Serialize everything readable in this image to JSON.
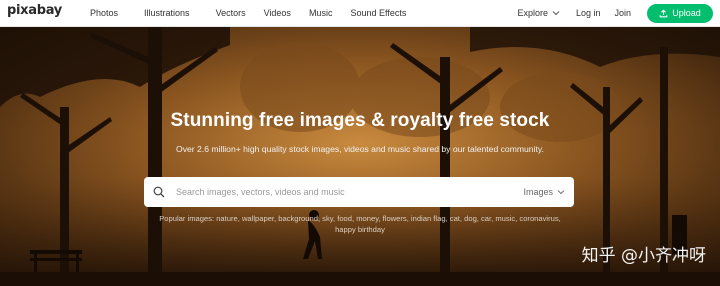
{
  "header": {
    "logo": "pixabay",
    "nav": [
      "Photos",
      "Illustrations",
      "Vectors",
      "Videos",
      "Music",
      "Sound Effects"
    ],
    "explore_label": "Explore",
    "login_label": "Log in",
    "join_label": "Join",
    "upload_label": "Upload",
    "accent_color": "#02be6e"
  },
  "hero": {
    "headline": "Stunning free images & royalty free stock",
    "subline": "Over 2.6 million+ high quality stock images, videos and music shared by our talented community.",
    "search": {
      "placeholder": "Search images, vectors, videos and music",
      "type_selected": "Images"
    },
    "popular_line1": "Popular images: nature, wallpaper, background, sky, food, money, flowers, indian flag, cat, dog, car, music, coronavirus,",
    "popular_line2": "happy birthday"
  },
  "watermark": "知乎 @小齐冲呀"
}
